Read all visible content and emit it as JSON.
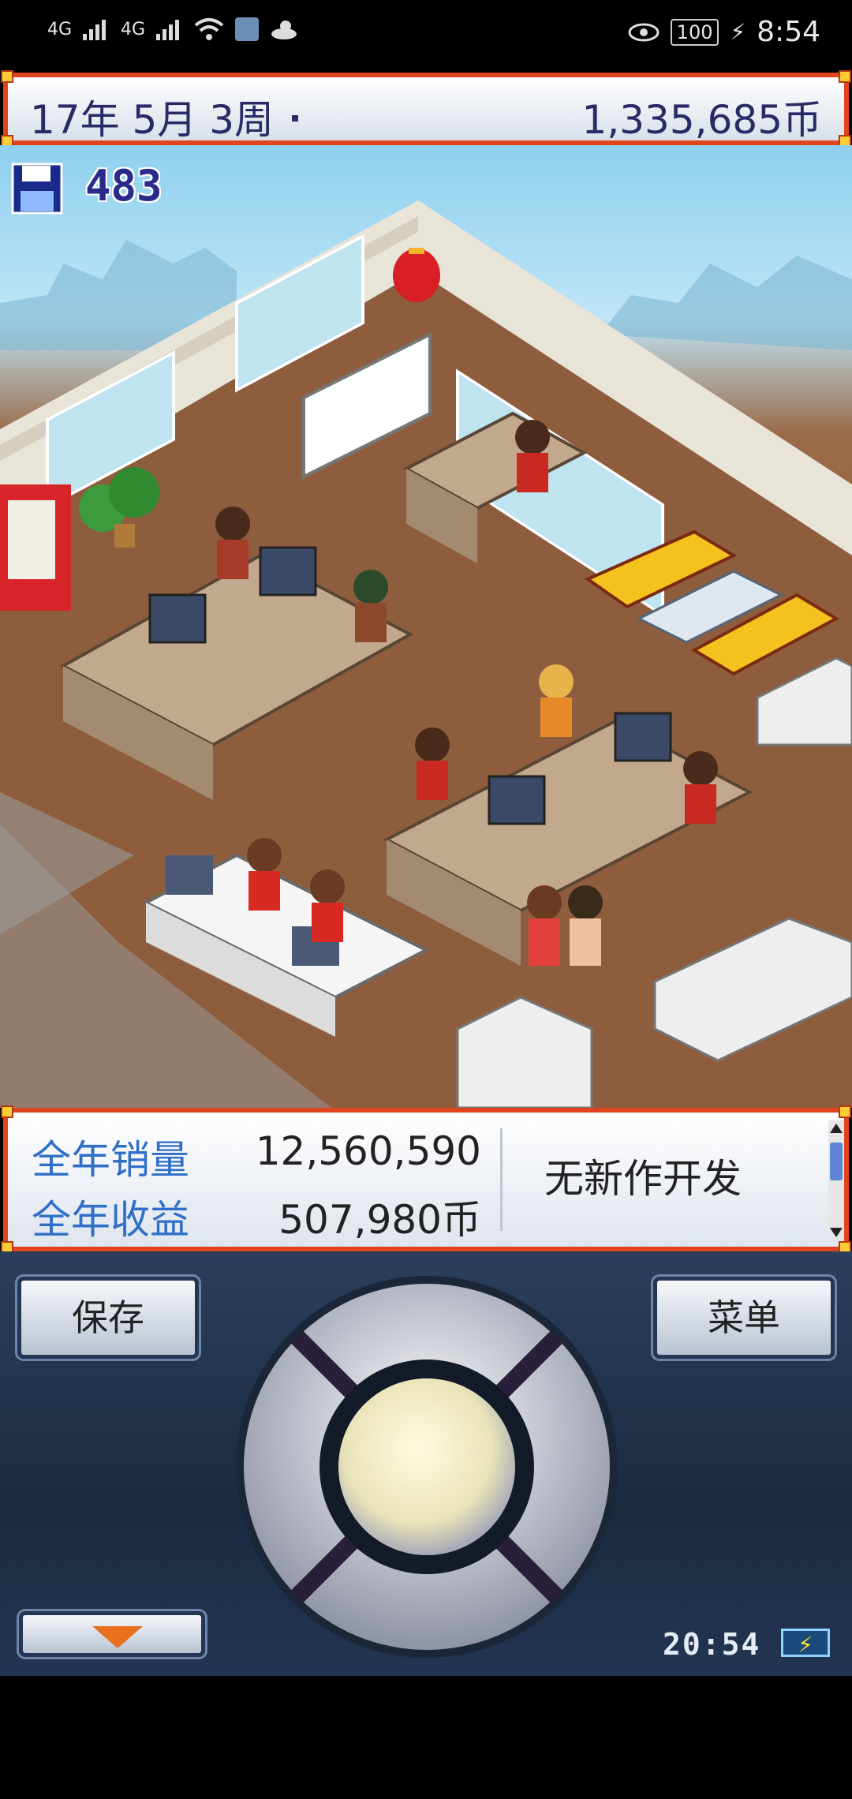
{
  "status_bar": {
    "signal1": "4G",
    "signal2": "4G",
    "battery": "100",
    "time": "8:54"
  },
  "header": {
    "date": "17年 5月 3周",
    "money": "1,335,685币"
  },
  "scene": {
    "save_count": "483"
  },
  "info_panel": {
    "annual_sales_label": "全年销量",
    "annual_sales_value": "12,560,590",
    "annual_profit_label": "全年收益",
    "annual_profit_value": "507,980币",
    "status_message": "无新作开发"
  },
  "controls": {
    "save_label": "保存",
    "menu_label": "菜单",
    "game_clock": "20:54"
  },
  "colors": {
    "frame": "#e2451e",
    "label_blue": "#2f6fc7",
    "panel_dark": "#1a2a40"
  }
}
